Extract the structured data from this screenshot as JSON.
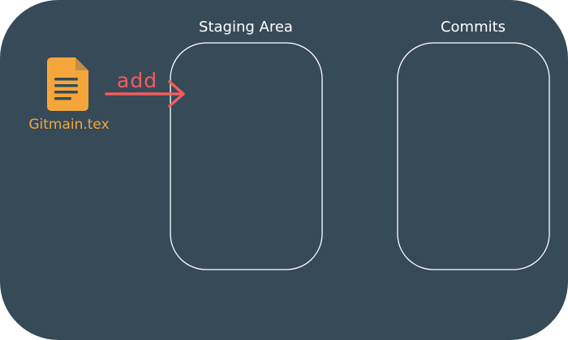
{
  "colors": {
    "background": "#364a58",
    "file_icon": "#f5a63b",
    "file_lines": "#364a58",
    "file_label": "#f5a63b",
    "action": "#f45b5b",
    "box_stroke": "#ffffff",
    "title": "#ffffff"
  },
  "file": {
    "icon": "document-icon",
    "name": "Gitmain.tex"
  },
  "action": {
    "label": "add",
    "icon": "right-arrow-icon"
  },
  "areas": {
    "staging": {
      "title": "Staging Area"
    },
    "commits": {
      "title": "Commits"
    }
  }
}
